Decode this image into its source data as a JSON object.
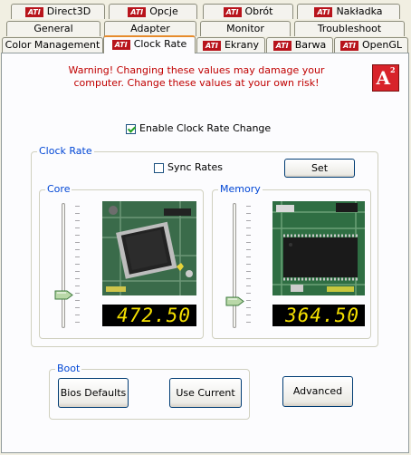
{
  "tabs": {
    "row1": [
      {
        "label": "Direct3D",
        "ati": "ATI"
      },
      {
        "label": "Opcje",
        "ati": "ATI"
      },
      {
        "label": "Obrót",
        "ati": "ATI"
      },
      {
        "label": "Nakładka",
        "ati": "ATI"
      }
    ],
    "row2": [
      {
        "label": "General"
      },
      {
        "label": "Adapter"
      },
      {
        "label": "Monitor"
      },
      {
        "label": "Troubleshoot"
      }
    ],
    "row3": [
      {
        "label": "Color Management"
      },
      {
        "label": "Clock Rate",
        "ati": "ATI",
        "active": true
      },
      {
        "label": "Ekrany",
        "ati": "ATI"
      },
      {
        "label": "Barwa",
        "ati": "ATI"
      },
      {
        "label": "OpenGL",
        "ati": "ATI"
      }
    ]
  },
  "warning": "Warning!  Changing these values may damage your computer.  Change these values at your own risk!",
  "logo": {
    "letter": "A",
    "sup": "2"
  },
  "enable_clock": {
    "label": "Enable Clock Rate Change",
    "checked": true
  },
  "clock_rate": {
    "title": "Clock Rate",
    "sync_label": "Sync Rates",
    "sync_checked": false,
    "set_label": "Set",
    "core": {
      "title": "Core",
      "value": "472.50",
      "level": 0.0
    },
    "memory": {
      "title": "Memory",
      "value": "364.50",
      "level": 0.0
    }
  },
  "boot": {
    "title": "Boot",
    "bios_label": "Bios Defaults",
    "use_current_label": "Use Current"
  },
  "advanced_label": "Advanced",
  "colors": {
    "accent_tab": "#e68b2c",
    "warning": "#c00000",
    "group_title": "#0046d5",
    "lcd": "#f5e000"
  }
}
